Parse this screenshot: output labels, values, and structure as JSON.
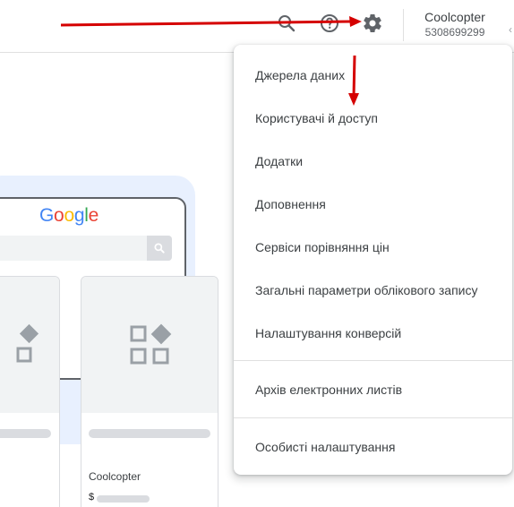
{
  "header": {
    "account_name": "Coolcopter",
    "account_id": "5308699299",
    "edge_glyph": "‹"
  },
  "icons": {
    "search": "search-icon",
    "help": "help-icon",
    "settings": "gear-icon"
  },
  "illustration": {
    "logo_text": "Google",
    "card_brand": "Coolcopter",
    "card_price_symbol": "$"
  },
  "settings_menu": {
    "items": [
      {
        "label": "Джерела даних"
      },
      {
        "label": "Користувачі й доступ"
      },
      {
        "label": "Додатки"
      },
      {
        "label": "Доповнення"
      },
      {
        "label": "Сервіси порівняння цін"
      },
      {
        "label": "Загальні параметри облікового запису"
      },
      {
        "label": "Налаштування конверсій"
      },
      {
        "label": "Архів електронних листів"
      },
      {
        "label": "Особисті налаштування"
      }
    ]
  },
  "colors": {
    "annotation_arrow": "#d50000",
    "google_blue": "#4285f4",
    "google_red": "#ea4335",
    "google_yellow": "#fbbc05",
    "google_green": "#34a853",
    "icon_gray": "#5f6368"
  }
}
